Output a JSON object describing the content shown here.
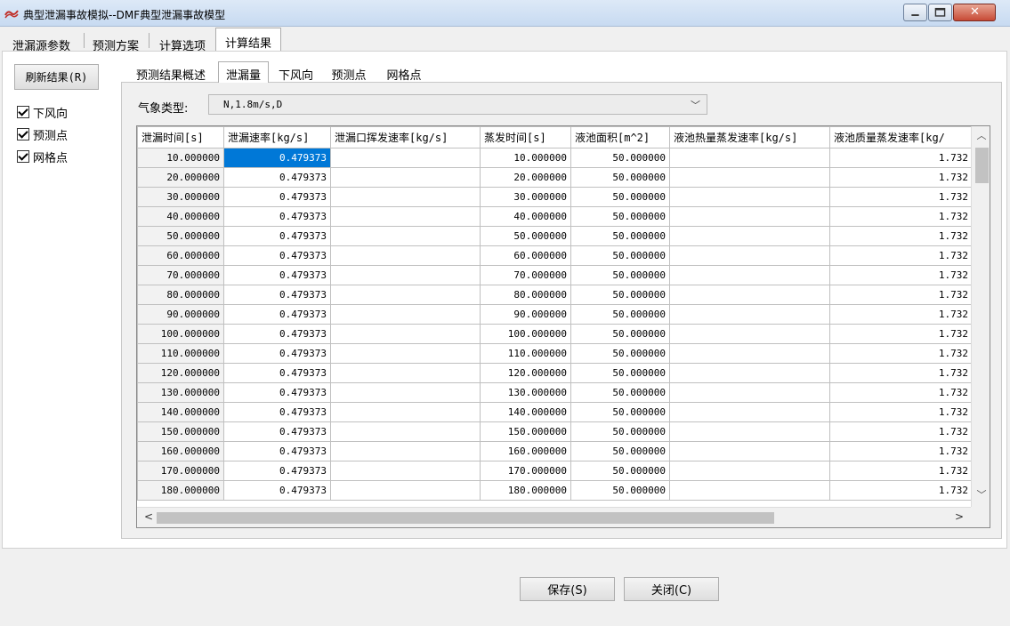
{
  "window": {
    "title": "典型泄漏事故模拟--DMF典型泄漏事故模型",
    "icons": {
      "app": "app-logo-icon",
      "minimize": "minimize-icon",
      "maximize": "maximize-icon",
      "close": "close-icon"
    }
  },
  "main_tabs": [
    {
      "label": "泄漏源参数"
    },
    {
      "label": "预测方案"
    },
    {
      "label": "计算选项"
    },
    {
      "label": "计算结果",
      "active": true
    }
  ],
  "sidebar": {
    "refresh_label": "刷新结果(R)",
    "checks": [
      {
        "label": "下风向",
        "checked": true
      },
      {
        "label": "预测点",
        "checked": true
      },
      {
        "label": "网格点",
        "checked": true
      }
    ]
  },
  "sub_tabs": [
    {
      "label": "预测结果概述"
    },
    {
      "label": "泄漏量",
      "active": true
    },
    {
      "label": "下风向"
    },
    {
      "label": "预测点"
    },
    {
      "label": "网格点"
    }
  ],
  "weather": {
    "label": "气象类型:",
    "value": "N,1.8m/s,D"
  },
  "table": {
    "columns": [
      "泄漏时间[s]",
      "泄漏速率[kg/s]",
      "泄漏口挥发速率[kg/s]",
      "蒸发时间[s]",
      "液池面积[m^2]",
      "液池热量蒸发速率[kg/s]",
      "液池质量蒸发速率[kg/"
    ],
    "rows": [
      [
        "10.000000",
        "0.479373",
        "",
        "10.000000",
        "50.000000",
        "",
        "1.732"
      ],
      [
        "20.000000",
        "0.479373",
        "",
        "20.000000",
        "50.000000",
        "",
        "1.732"
      ],
      [
        "30.000000",
        "0.479373",
        "",
        "30.000000",
        "50.000000",
        "",
        "1.732"
      ],
      [
        "40.000000",
        "0.479373",
        "",
        "40.000000",
        "50.000000",
        "",
        "1.732"
      ],
      [
        "50.000000",
        "0.479373",
        "",
        "50.000000",
        "50.000000",
        "",
        "1.732"
      ],
      [
        "60.000000",
        "0.479373",
        "",
        "60.000000",
        "50.000000",
        "",
        "1.732"
      ],
      [
        "70.000000",
        "0.479373",
        "",
        "70.000000",
        "50.000000",
        "",
        "1.732"
      ],
      [
        "80.000000",
        "0.479373",
        "",
        "80.000000",
        "50.000000",
        "",
        "1.732"
      ],
      [
        "90.000000",
        "0.479373",
        "",
        "90.000000",
        "50.000000",
        "",
        "1.732"
      ],
      [
        "100.000000",
        "0.479373",
        "",
        "100.000000",
        "50.000000",
        "",
        "1.732"
      ],
      [
        "110.000000",
        "0.479373",
        "",
        "110.000000",
        "50.000000",
        "",
        "1.732"
      ],
      [
        "120.000000",
        "0.479373",
        "",
        "120.000000",
        "50.000000",
        "",
        "1.732"
      ],
      [
        "130.000000",
        "0.479373",
        "",
        "130.000000",
        "50.000000",
        "",
        "1.732"
      ],
      [
        "140.000000",
        "0.479373",
        "",
        "140.000000",
        "50.000000",
        "",
        "1.732"
      ],
      [
        "150.000000",
        "0.479373",
        "",
        "150.000000",
        "50.000000",
        "",
        "1.732"
      ],
      [
        "160.000000",
        "0.479373",
        "",
        "160.000000",
        "50.000000",
        "",
        "1.732"
      ],
      [
        "170.000000",
        "0.479373",
        "",
        "170.000000",
        "50.000000",
        "",
        "1.732"
      ],
      [
        "180.000000",
        "0.479373",
        "",
        "180.000000",
        "50.000000",
        "",
        "1.732"
      ]
    ]
  },
  "footer": {
    "save_label": "保存(S)",
    "close_label": "关闭(C)"
  },
  "colors": {
    "selection": "#0078d7",
    "title_gradient_top": "#dde9f7",
    "close_button": "#c74a36"
  }
}
